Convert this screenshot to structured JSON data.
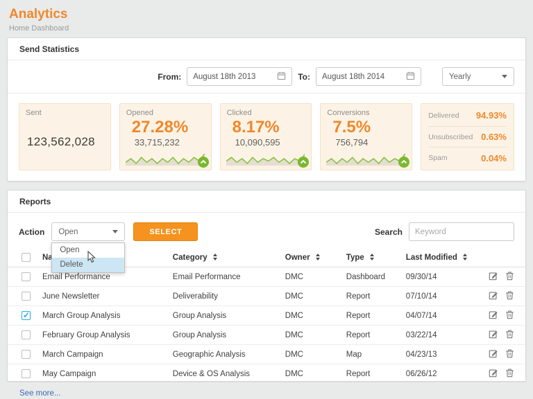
{
  "page": {
    "title": "Analytics",
    "subtitle": "Home Dashboard"
  },
  "send_statistics": {
    "title": "Send Statistics",
    "from_label": "From:",
    "from_value": "August 18th 2013",
    "to_label": "To:",
    "to_value": "August 18th 2014",
    "period_value": "Yearly",
    "cards": {
      "sent": {
        "label": "Sent",
        "value": "123,562,028"
      },
      "opened": {
        "label": "Opened",
        "pct": "27.28%",
        "count": "33,715,232",
        "spark": [
          5,
          8,
          4,
          9,
          5,
          8,
          4,
          8,
          5,
          9,
          4,
          8,
          5,
          9,
          6,
          12
        ]
      },
      "clicked": {
        "label": "Clicked",
        "pct": "8.17%",
        "count": "10,090,595",
        "spark": [
          6,
          9,
          5,
          8,
          4,
          9,
          5,
          8,
          6,
          9,
          5,
          8,
          4,
          8,
          6,
          12
        ]
      },
      "conversions": {
        "label": "Conversions",
        "pct": "7.5%",
        "count": "756,794",
        "spark": [
          5,
          8,
          4,
          8,
          5,
          9,
          4,
          8,
          5,
          8,
          4,
          9,
          5,
          8,
          6,
          12
        ]
      }
    },
    "summary": [
      {
        "label": "Delivered",
        "value": "94.93%"
      },
      {
        "label": "Unsubscribed",
        "value": "0.63%"
      },
      {
        "label": "Spam",
        "value": "0.04%"
      }
    ],
    "colors": {
      "accent": "#f0882b",
      "card_bg": "#fcf3e6",
      "spark_green": "#85c23d",
      "badge_green": "#7bb82e"
    }
  },
  "reports": {
    "title": "Reports",
    "action_label": "Action",
    "action_value": "Open",
    "action_options": [
      "Open",
      "Delete"
    ],
    "highlighted_option": "Delete",
    "select_button": "SELECT",
    "search_label": "Search",
    "search_placeholder": "Keyword",
    "table": {
      "headers": {
        "name": "Name",
        "category": "Category",
        "owner": "Owner",
        "type": "Type",
        "modified": "Last Modified"
      },
      "rows": [
        {
          "name": "Email Performance",
          "category": "Email Performance",
          "owner": "DMC",
          "type": "Dashboard",
          "modified": "09/30/14",
          "checked": false
        },
        {
          "name": "June Newsletter",
          "category": "Deliverability",
          "owner": "DMC",
          "type": "Report",
          "modified": "07/10/14",
          "checked": false
        },
        {
          "name": "March Group Analysis",
          "category": "Group Analysis",
          "owner": "DMC",
          "type": "Report",
          "modified": "04/07/14",
          "checked": true
        },
        {
          "name": "February Group Analysis",
          "category": "Group Analysis",
          "owner": "DMC",
          "type": "Report",
          "modified": "03/22/14",
          "checked": false
        },
        {
          "name": "March Campaign",
          "category": "Geographic Analysis",
          "owner": "DMC",
          "type": "Map",
          "modified": "04/23/13",
          "checked": false
        },
        {
          "name": "May Campaign",
          "category": "Device & OS Analysis",
          "owner": "DMC",
          "type": "Report",
          "modified": "06/26/12",
          "checked": false
        }
      ],
      "see_more": "See more...",
      "checkbox_color": "#29abe2"
    }
  }
}
